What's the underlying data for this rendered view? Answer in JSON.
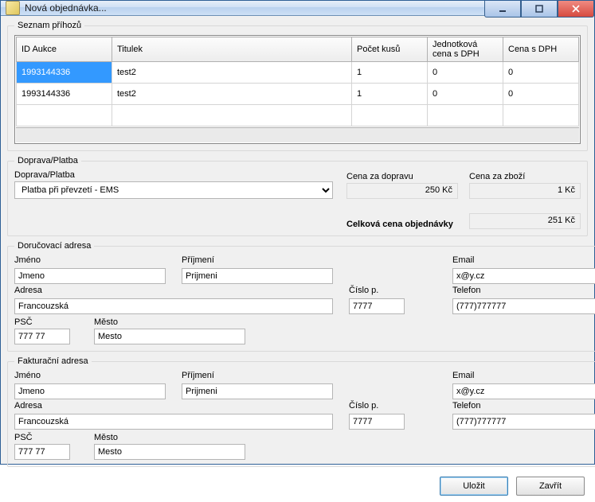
{
  "window": {
    "title": "Nová objednávka..."
  },
  "bids": {
    "legend": "Seznam příhozů",
    "headers": {
      "id": "ID Aukce",
      "title": "Titulek",
      "qty": "Počet kusů",
      "unit": "Jednotková cena s DPH",
      "total": "Cena s DPH"
    },
    "rows": [
      {
        "id": "1993144336",
        "title": "test2",
        "qty": "1",
        "unit": "0",
        "total": "0"
      },
      {
        "id": "1993144336",
        "title": "test2",
        "qty": "1",
        "unit": "0",
        "total": "0"
      }
    ]
  },
  "transport": {
    "legend": "Doprava/Platba",
    "combo_label": "Doprava/Platba",
    "combo_value": "Platba při převzetí - EMS",
    "shipping_label": "Cena za dopravu",
    "shipping_value": "250 Kč",
    "goods_label": "Cena za zboží",
    "goods_value": "1 Kč",
    "total_label": "Celková cena objednávky",
    "total_value": "251 Kč"
  },
  "delivery": {
    "legend": "Doručovací adresa",
    "first_label": "Jméno",
    "first_value": "Jmeno",
    "last_label": "Příjmení",
    "last_value": "Prijmeni",
    "email_label": "Email",
    "email_value": "x@y.cz",
    "addr_label": "Adresa",
    "addr_value": "Francouzská",
    "num_label": "Číslo p.",
    "num_value": "7777",
    "phone_label": "Telefon",
    "phone_value": "(777)777777",
    "psc_label": "PSČ",
    "psc_value": "777 77",
    "city_label": "Město",
    "city_value": "Mesto"
  },
  "billing": {
    "legend": "Fakturační adresa",
    "first_label": "Jméno",
    "first_value": "Jmeno",
    "last_label": "Příjmení",
    "last_value": "Prijmeni",
    "email_label": "Email",
    "email_value": "x@y.cz",
    "addr_label": "Adresa",
    "addr_value": "Francouzská",
    "num_label": "Číslo p.",
    "num_value": "7777",
    "phone_label": "Telefon",
    "phone_value": "(777)777777",
    "psc_label": "PSČ",
    "psc_value": "777 77",
    "city_label": "Město",
    "city_value": "Mesto"
  },
  "buttons": {
    "save": "Uložit",
    "close": "Zavřít"
  }
}
